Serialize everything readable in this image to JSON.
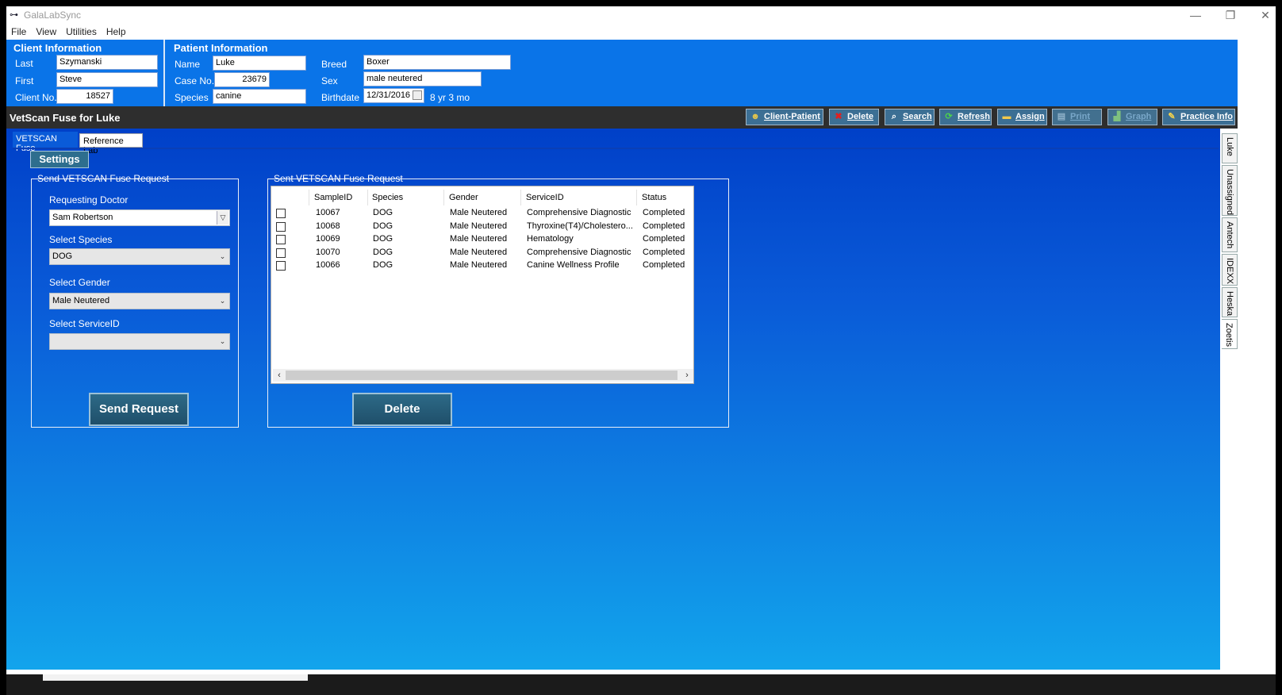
{
  "window": {
    "title": "GalaLabSync",
    "controls": {
      "minimize": "—",
      "restore": "❐",
      "close": "✕"
    }
  },
  "menu": [
    "File",
    "View",
    "Utilities",
    "Help"
  ],
  "client": {
    "heading": "Client Information",
    "last_label": "Last",
    "last": "Szymanski",
    "first_label": "First",
    "first": "Steve",
    "clientno_label": "Client No.",
    "clientno": "18527"
  },
  "patient": {
    "heading": "Patient Information",
    "name_label": "Name",
    "name": "Luke",
    "caseno_label": "Case No.",
    "caseno": "23679",
    "species_label": "Species",
    "species": "canine",
    "breed_label": "Breed",
    "breed": "Boxer",
    "sex_label": "Sex",
    "sex": "male neutered",
    "birthdate_label": "Birthdate",
    "birthdate": "12/31/2016",
    "age": "8 yr  3 mo"
  },
  "toolbar": {
    "title": "VetScan Fuse for Luke",
    "buttons": {
      "client_patient": "Client-Patient",
      "delete": "Delete",
      "search": "Search",
      "refresh": "Refresh",
      "assign": "Assign",
      "print": "Print",
      "graph": "Graph",
      "practice_info": "Practice Info"
    }
  },
  "tabs": {
    "active": "VETSCAN Fuse",
    "other": "Reference Lab"
  },
  "settings_label": "Settings",
  "send_group": {
    "title": "Send VETSCAN Fuse Request",
    "doctor_label": "Requesting Doctor",
    "doctor": "Sam Robertson",
    "species_label": "Select Species",
    "species": "DOG",
    "gender_label": "Select Gender",
    "gender": "Male Neutered",
    "service_label": "Select ServiceID",
    "service": "",
    "send_button": "Send Request"
  },
  "sent_group": {
    "title": "Sent VETSCAN Fuse Request",
    "columns": [
      "SampleID",
      "Species",
      "Gender",
      "ServiceID",
      "Status"
    ],
    "rows": [
      [
        "10067",
        "DOG",
        "Male Neutered",
        "Comprehensive Diagnostic",
        "Completed"
      ],
      [
        "10068",
        "DOG",
        "Male Neutered",
        "Thyroxine(T4)/Cholestero...",
        "Completed"
      ],
      [
        "10069",
        "DOG",
        "Male Neutered",
        "Hematology",
        "Completed"
      ],
      [
        "10070",
        "DOG",
        "Male Neutered",
        "Comprehensive Diagnostic",
        "Completed"
      ],
      [
        "10066",
        "DOG",
        "Male Neutered",
        "Canine Wellness Profile",
        "Completed"
      ]
    ],
    "delete_button": "Delete"
  },
  "side_tabs": [
    "Luke",
    "Unassigned",
    "Antech",
    "IDEXX",
    "Heska",
    "Zoetis"
  ],
  "colors": {
    "info_bar": "#0a74e8",
    "toolbar": "#2e2e2e",
    "button": "#2e6e8e",
    "content_top": "#0040c8",
    "content_bottom": "#12a4ec"
  },
  "icons": {
    "client_patient": "people-icon",
    "delete": "red-x-icon",
    "search": "magnifier-icon",
    "refresh": "refresh-icon",
    "assign": "folder-icon",
    "print": "printer-icon",
    "graph": "chart-icon",
    "practice_info": "notepad-icon"
  }
}
